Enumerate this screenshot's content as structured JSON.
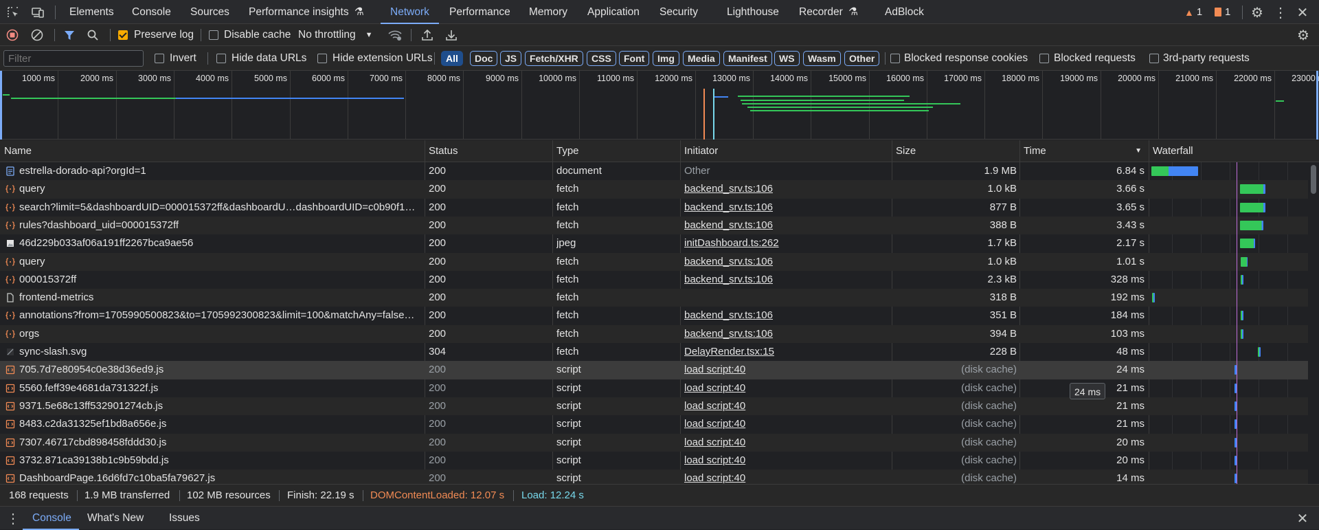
{
  "tabs": {
    "items": [
      "Elements",
      "Console",
      "Sources",
      "Performance insights",
      "Network",
      "Performance",
      "Memory",
      "Application",
      "Security",
      "Lighthouse",
      "Recorder",
      "AdBlock"
    ],
    "active": "Network",
    "warnings_count": "1",
    "issues_count": "1"
  },
  "toolbar": {
    "preserve_log": "Preserve log",
    "disable_cache": "Disable cache",
    "throttling": "No throttling"
  },
  "filter": {
    "placeholder": "Filter",
    "invert": "Invert",
    "hide_data_urls": "Hide data URLs",
    "hide_extension_urls": "Hide extension URLs",
    "types": [
      "All",
      "Doc",
      "JS",
      "Fetch/XHR",
      "CSS",
      "Font",
      "Img",
      "Media",
      "Manifest",
      "WS",
      "Wasm",
      "Other"
    ],
    "active_type": "All",
    "blocked_cookies": "Blocked response cookies",
    "blocked_requests": "Blocked requests",
    "third_party": "3rd-party requests"
  },
  "overview": {
    "ticks": [
      "1000 ms",
      "2000 ms",
      "3000 ms",
      "4000 ms",
      "5000 ms",
      "6000 ms",
      "7000 ms",
      "8000 ms",
      "9000 ms",
      "10000 ms",
      "11000 ms",
      "12000 ms",
      "13000 ms",
      "14000 ms",
      "15000 ms",
      "16000 ms",
      "17000 ms",
      "18000 ms",
      "19000 ms",
      "20000 ms",
      "21000 ms",
      "22000 ms",
      "23000 ms"
    ]
  },
  "columns": {
    "name": "Name",
    "status": "Status",
    "type": "Type",
    "initiator": "Initiator",
    "size": "Size",
    "time": "Time",
    "waterfall": "Waterfall"
  },
  "rows": [
    {
      "icon": "document-icon",
      "name": "estrella-dorado-api?orgId=1",
      "status": "200",
      "type": "document",
      "initiator": "Other",
      "initiator_link": false,
      "size": "1.9 MB",
      "time": "6.84 s",
      "wf_start_ms": 0,
      "wf_end_ms": 6840
    },
    {
      "icon": "fetch-icon",
      "name": "query",
      "status": "200",
      "type": "fetch",
      "initiator": "backend_srv.ts:106",
      "initiator_link": true,
      "size": "1.0 kB",
      "time": "3.66 s",
      "wf_start_ms": 12900,
      "wf_end_ms": 16560
    },
    {
      "icon": "fetch-icon",
      "name": "search?limit=5&dashboardUID=000015372ff&dashboardU…dashboardUID=c0b90f1…",
      "status": "200",
      "type": "fetch",
      "initiator": "backend_srv.ts:106",
      "initiator_link": true,
      "size": "877 B",
      "time": "3.65 s",
      "wf_start_ms": 12900,
      "wf_end_ms": 16550
    },
    {
      "icon": "fetch-icon",
      "name": "rules?dashboard_uid=000015372ff",
      "status": "200",
      "type": "fetch",
      "initiator": "backend_srv.ts:106",
      "initiator_link": true,
      "size": "388 B",
      "time": "3.43 s",
      "wf_start_ms": 12900,
      "wf_end_ms": 16330
    },
    {
      "icon": "image-icon",
      "name": "46d229b033af06a191ff2267bca9ae56",
      "status": "200",
      "type": "jpeg",
      "initiator": "initDashboard.ts:262",
      "initiator_link": true,
      "size": "1.7 kB",
      "time": "2.17 s",
      "wf_start_ms": 12900,
      "wf_end_ms": 15070
    },
    {
      "icon": "fetch-icon",
      "name": "query",
      "status": "200",
      "type": "fetch",
      "initiator": "backend_srv.ts:106",
      "initiator_link": true,
      "size": "1.0 kB",
      "time": "1.01 s",
      "wf_start_ms": 12950,
      "wf_end_ms": 13960
    },
    {
      "icon": "fetch-icon",
      "name": "000015372ff",
      "status": "200",
      "type": "fetch",
      "initiator": "backend_srv.ts:106",
      "initiator_link": true,
      "size": "2.3 kB",
      "time": "328 ms",
      "wf_start_ms": 12950,
      "wf_end_ms": 13278
    },
    {
      "icon": "file-icon",
      "name": "frontend-metrics",
      "status": "200",
      "type": "fetch",
      "initiator": "",
      "initiator_link": false,
      "size": "318 B",
      "time": "192 ms",
      "wf_start_ms": 100,
      "wf_end_ms": 292
    },
    {
      "icon": "fetch-icon",
      "name": "annotations?from=1705990500823&to=1705992300823&limit=100&matchAny=false…",
      "status": "200",
      "type": "fetch",
      "initiator": "backend_srv.ts:106",
      "initiator_link": true,
      "size": "351 B",
      "time": "184 ms",
      "wf_start_ms": 13000,
      "wf_end_ms": 13184
    },
    {
      "icon": "fetch-icon",
      "name": "orgs",
      "status": "200",
      "type": "fetch",
      "initiator": "backend_srv.ts:106",
      "initiator_link": true,
      "size": "394 B",
      "time": "103 ms",
      "wf_start_ms": 13000,
      "wf_end_ms": 13103
    },
    {
      "icon": "svg-icon",
      "name": "sync-slash.svg",
      "status": "304",
      "type": "fetch",
      "initiator": "DelayRender.tsx:15",
      "initiator_link": true,
      "size": "228 B",
      "time": "48 ms",
      "wf_start_ms": 15500,
      "wf_end_ms": 15548
    },
    {
      "icon": "script-icon",
      "name": "705.7d7e80954c0e38d36ed9.js",
      "status": "200",
      "type": "script",
      "initiator": "load script:40",
      "initiator_link": true,
      "size": "(disk cache)",
      "time": "24 ms",
      "wf_start_ms": 12050,
      "wf_end_ms": 12074,
      "hover": true
    },
    {
      "icon": "script-icon",
      "name": "5560.feff39e4681da731322f.js",
      "status": "200",
      "type": "script",
      "initiator": "load script:40",
      "initiator_link": true,
      "size": "(disk cache)",
      "time": "21 ms",
      "wf_start_ms": 12050,
      "wf_end_ms": 12071
    },
    {
      "icon": "script-icon",
      "name": "9371.5e68c13ff532901274cb.js",
      "status": "200",
      "type": "script",
      "initiator": "load script:40",
      "initiator_link": true,
      "size": "(disk cache)",
      "time": "21 ms",
      "wf_start_ms": 12050,
      "wf_end_ms": 12071
    },
    {
      "icon": "script-icon",
      "name": "8483.c2da31325ef1bd8a656e.js",
      "status": "200",
      "type": "script",
      "initiator": "load script:40",
      "initiator_link": true,
      "size": "(disk cache)",
      "time": "21 ms",
      "wf_start_ms": 12050,
      "wf_end_ms": 12071
    },
    {
      "icon": "script-icon",
      "name": "7307.46717cbd898458fddd30.js",
      "status": "200",
      "type": "script",
      "initiator": "load script:40",
      "initiator_link": true,
      "size": "(disk cache)",
      "time": "20 ms",
      "wf_start_ms": 12050,
      "wf_end_ms": 12070
    },
    {
      "icon": "script-icon",
      "name": "3732.871ca39138b1c9b59bdd.js",
      "status": "200",
      "type": "script",
      "initiator": "load script:40",
      "initiator_link": true,
      "size": "(disk cache)",
      "time": "20 ms",
      "wf_start_ms": 12050,
      "wf_end_ms": 12070
    },
    {
      "icon": "script-icon",
      "name": "DashboardPage.16d6fd7c10ba5fa79627.js",
      "status": "200",
      "type": "script",
      "initiator": "load script:40",
      "initiator_link": true,
      "size": "(disk cache)",
      "time": "14 ms",
      "wf_start_ms": 12050,
      "wf_end_ms": 12064
    }
  ],
  "tooltip": "24 ms",
  "status": {
    "requests": "168 requests",
    "transferred": "1.9 MB transferred",
    "resources": "102 MB resources",
    "finish": "Finish: 22.19 s",
    "dom_content_loaded": "DOMContentLoaded: 12.07 s",
    "load": "Load: 12.24 s"
  },
  "drawer": {
    "tabs": [
      "Console",
      "What's New",
      "Issues"
    ],
    "active": "Console"
  },
  "colors": {
    "accent": "#7cacf8",
    "dcl": "#f28b54",
    "load": "#78d9ec",
    "waterfall_green": "#1ea446",
    "waterfall_blue": "#4285f4",
    "waiting_green": "#34c759"
  }
}
